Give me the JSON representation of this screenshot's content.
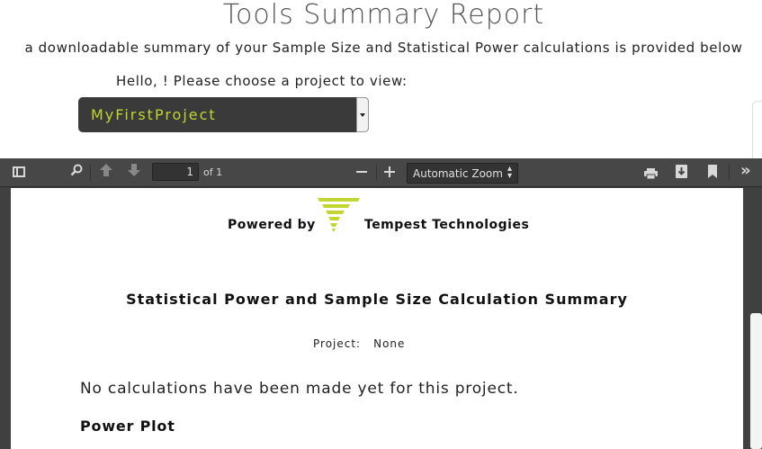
{
  "header": {
    "title": "Tools Summary Report",
    "subtitle": "a downloadable summary of your Sample Size and Statistical Power calculations is provided below",
    "greeting": "Hello, ! Please choose a project to view:"
  },
  "project_select": {
    "selected": "MyFirstProject",
    "text_color": "#c3d531",
    "background": "#3a3a3a"
  },
  "pdf_toolbar": {
    "page_number": "1",
    "page_count_label": "of 1",
    "zoom_label": "Automatic Zoom",
    "icons": [
      "sidebar-toggle-icon",
      "search-icon",
      "previous-page-icon",
      "next-page-icon",
      "zoom-out-icon",
      "zoom-in-icon",
      "print-icon",
      "download-icon",
      "bookmark-icon",
      "tools-icon"
    ]
  },
  "document": {
    "powered_by": "Powered by",
    "company": "Tempest Technologies",
    "logo_color": "#c3d531",
    "title": "Statistical Power and Sample Size Calculation Summary",
    "project_label": "Project:",
    "project_value": "None",
    "no_calculations": "No calculations have been made yet for this project.",
    "section_heading": "Power Plot"
  }
}
